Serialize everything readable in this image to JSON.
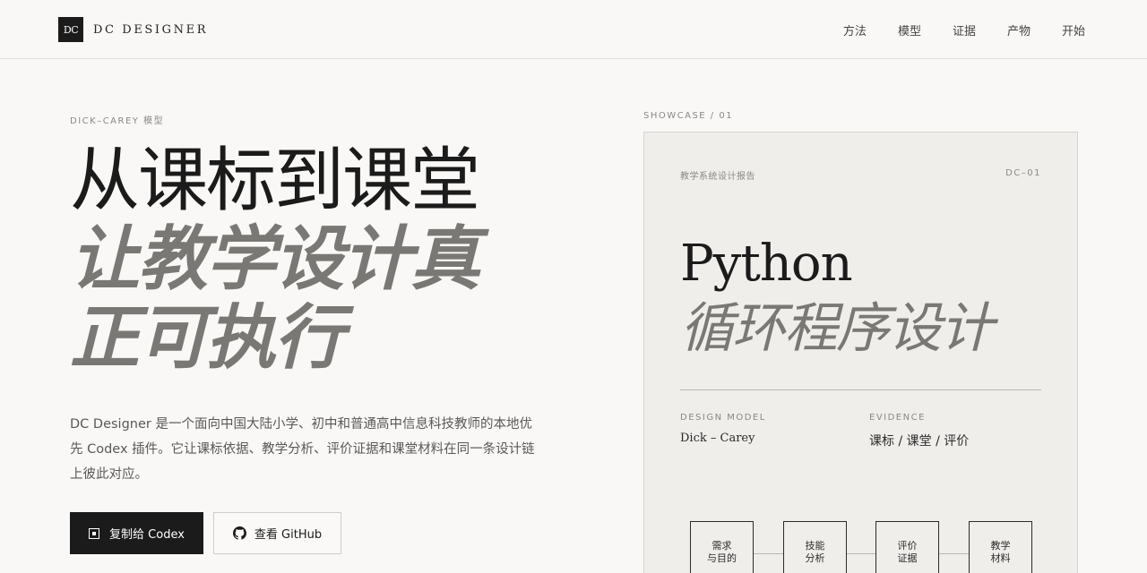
{
  "brand": {
    "mark": "DC",
    "name": "DC DESIGNER"
  },
  "nav": [
    "方法",
    "模型",
    "证据",
    "产物",
    "开始"
  ],
  "hero": {
    "eyebrow": "DICK–CAREY 模型",
    "headline_line1": "从课标到课堂",
    "headline_line2": "让教学设计真",
    "headline_line3": "正可执行",
    "description": "DC Designer 是一个面向中国大陆小学、初中和普通高中信息科技教师的本地优先 Codex 插件。它让课标依据、教学分析、评价证据和课堂材料在同一条设计链上彼此对应。",
    "primary_button": "复制给 Codex",
    "secondary_button": "查看 GitHub"
  },
  "showcase": {
    "label": "SHOWCASE / 01",
    "card_subtitle": "教学系统设计报告",
    "card_code": "DC–01",
    "title_line1": "Python",
    "title_line2": "循环程序设计",
    "design_model_label": "DESIGN MODEL",
    "design_model_value": "Dick – Carey",
    "evidence_label": "EVIDENCE",
    "evidence_value": "课标 / 课堂 / 评价",
    "flow_steps": [
      "需求\n与目的",
      "技能\n分析",
      "评价\n证据",
      "教学\n材料"
    ]
  },
  "colors": {
    "ink": "#1b1b1b",
    "muted": "#7a7875",
    "paper": "#f9f8f6",
    "card": "#efeeeb"
  },
  "icons": {
    "primary_button": "square-icon",
    "secondary_button": "github-icon"
  }
}
